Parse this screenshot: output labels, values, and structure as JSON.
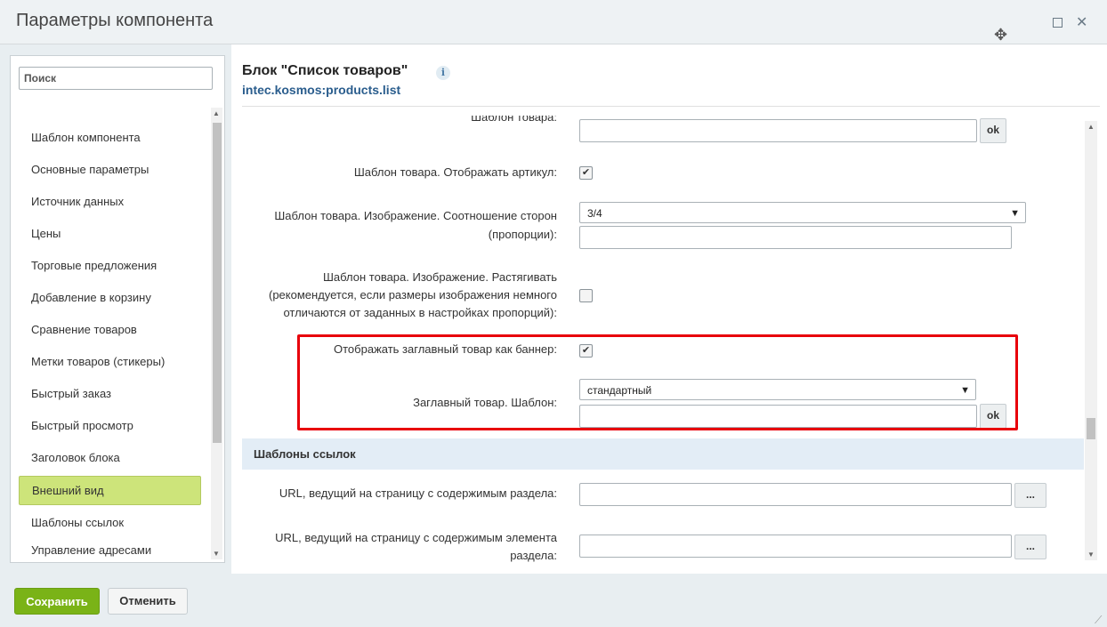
{
  "window": {
    "title": "Параметры компонента"
  },
  "sidebar": {
    "search_placeholder": "Поиск",
    "items": [
      "Шаблон компонента",
      "Основные параметры",
      "Источник данных",
      "Цены",
      "Торговые предложения",
      "Добавление в корзину",
      "Сравнение товаров",
      "Метки товаров (стикеры)",
      "Быстрый заказ",
      "Быстрый просмотр",
      "Заголовок блока",
      "Внешний вид",
      "Шаблоны ссылок",
      "Управление адресами"
    ],
    "active_index": 11
  },
  "main": {
    "block_title": "Блок \"Список товаров\"",
    "info_glyph": "i",
    "block_code": "intec.kosmos:products.list",
    "rows": {
      "partial_label": "Шаблон товара:",
      "ok_label": "ok",
      "show_article_label": "Шаблон товара. Отображать артикул:",
      "aspect_label_1": "Шаблон товара. Изображение. Соотношение сторон",
      "aspect_label_2": "(пропорции):",
      "aspect_value": "3/4",
      "stretch_label_1": "Шаблон товара. Изображение. Растягивать",
      "stretch_label_2": "(рекомендуется, если размеры изображения немного",
      "stretch_label_3": "отличаются от заданных в настройках пропорций):",
      "banner_label": "Отображать заглавный товар как баннер:",
      "main_template_label": "Заглавный товар. Шаблон:",
      "main_template_value": "стандартный"
    },
    "links_section": {
      "title": "Шаблоны ссылок",
      "section_url_label": "URL, ведущий на страницу с содержимым раздела:",
      "element_url_label_1": "URL, ведущий на страницу с содержимым элемента",
      "element_url_label_2": "раздела:",
      "browse_label": "..."
    }
  },
  "footer": {
    "save_label": "Сохранить",
    "cancel_label": "Отменить"
  },
  "colors": {
    "accent_green": "#7ab317",
    "active_item": "#cde47a",
    "highlight_red": "#e8000b",
    "link_blue": "#2a5d8d"
  }
}
